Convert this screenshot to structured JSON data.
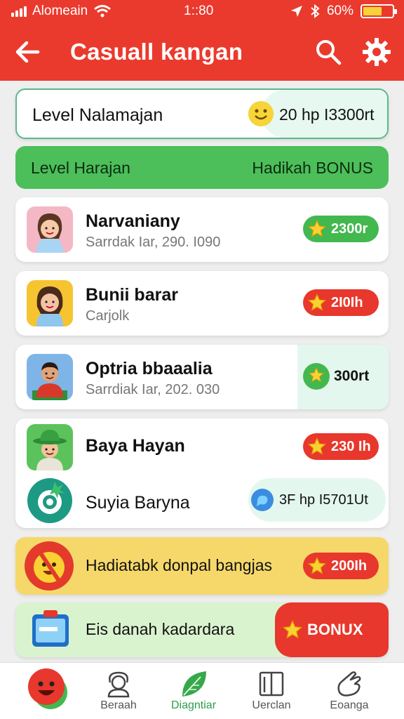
{
  "status_bar": {
    "carrier": "Alomeain",
    "time": "1::80",
    "battery": "60%"
  },
  "app_bar": {
    "title": "Casuall kangan"
  },
  "summary_card": {
    "label": "Level Nalamajan",
    "value": "20 hp I3300rt"
  },
  "bonus_banner": {
    "left_label": "Level Harajan",
    "right_label": "Hadikah BONUS"
  },
  "list": [
    {
      "name": "Narvaniany",
      "sub": "Sarrdak Iar, 290. I090",
      "reward": "2300r"
    },
    {
      "name": "Bunii barar",
      "sub": "Carjolk",
      "reward": "2I0Ih"
    },
    {
      "name": "Optria bbaaalia",
      "sub": "Sarrdiak Iar, 202. 030",
      "reward": "300rt"
    },
    {
      "name": "Baya Hayan",
      "sub": "",
      "reward": "230 Ih"
    },
    {
      "name": "Suyia Baryna",
      "sub": "",
      "reward": "3F hp I5701Ut"
    }
  ],
  "promo_yellow": {
    "text": "Hadiatabk donpal bangjas",
    "reward": "200Ih"
  },
  "promo_green": {
    "text": "Eis danah kadardara",
    "button": "BONUX"
  },
  "bottom_nav": [
    {
      "label": ""
    },
    {
      "label": "Beraah"
    },
    {
      "label": "Diagntiar"
    },
    {
      "label": "Uerclan"
    },
    {
      "label": "Eoanga"
    }
  ],
  "colors": {
    "header": "#ea3a2d",
    "green": "#4cbf5a",
    "red_pill": "#e8372c",
    "green_pill": "#43b84f",
    "yellow_banner": "#f6d86a"
  },
  "icons": [
    "back-arrow-icon",
    "search-icon",
    "gear-icon",
    "star-icon",
    "smiley-icon",
    "chat-bubble-icon"
  ]
}
